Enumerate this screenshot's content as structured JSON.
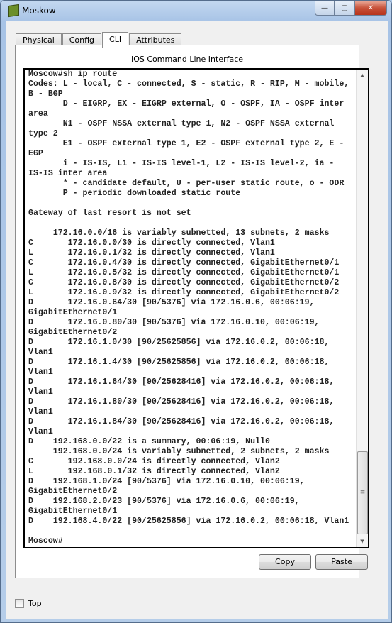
{
  "window": {
    "title": "Moskow",
    "minimize": "—",
    "maximize": "▢",
    "close": "✕"
  },
  "tabs": [
    {
      "label": "Physical",
      "active": false
    },
    {
      "label": "Config",
      "active": false
    },
    {
      "label": "CLI",
      "active": true
    },
    {
      "label": "Attributes",
      "active": false
    }
  ],
  "cli": {
    "heading": "IOS Command Line Interface",
    "output": "Moscow#sh ip route\nCodes: L - local, C - connected, S - static, R - RIP, M - mobile,\nB - BGP\n       D - EIGRP, EX - EIGRP external, O - OSPF, IA - OSPF inter\narea\n       N1 - OSPF NSSA external type 1, N2 - OSPF NSSA external\ntype 2\n       E1 - OSPF external type 1, E2 - OSPF external type 2, E -\nEGP\n       i - IS-IS, L1 - IS-IS level-1, L2 - IS-IS level-2, ia -\nIS-IS inter area\n       * - candidate default, U - per-user static route, o - ODR\n       P - periodic downloaded static route\n\nGateway of last resort is not set\n\n     172.16.0.0/16 is variably subnetted, 13 subnets, 2 masks\nC       172.16.0.0/30 is directly connected, Vlan1\nL       172.16.0.1/32 is directly connected, Vlan1\nC       172.16.0.4/30 is directly connected, GigabitEthernet0/1\nL       172.16.0.5/32 is directly connected, GigabitEthernet0/1\nC       172.16.0.8/30 is directly connected, GigabitEthernet0/2\nL       172.16.0.9/32 is directly connected, GigabitEthernet0/2\nD       172.16.0.64/30 [90/5376] via 172.16.0.6, 00:06:19,\nGigabitEthernet0/1\nD       172.16.0.80/30 [90/5376] via 172.16.0.10, 00:06:19,\nGigabitEthernet0/2\nD       172.16.1.0/30 [90/25625856] via 172.16.0.2, 00:06:18,\nVlan1\nD       172.16.1.4/30 [90/25625856] via 172.16.0.2, 00:06:18,\nVlan1\nD       172.16.1.64/30 [90/25628416] via 172.16.0.2, 00:06:18,\nVlan1\nD       172.16.1.80/30 [90/25628416] via 172.16.0.2, 00:06:18,\nVlan1\nD       172.16.1.84/30 [90/25628416] via 172.16.0.2, 00:06:18,\nVlan1\nD    192.168.0.0/22 is a summary, 00:06:19, Null0\n     192.168.0.0/24 is variably subnetted, 2 subnets, 2 masks\nC       192.168.0.0/24 is directly connected, Vlan2\nL       192.168.0.1/32 is directly connected, Vlan2\nD    192.168.1.0/24 [90/5376] via 172.16.0.10, 00:06:19,\nGigabitEthernet0/2\nD    192.168.2.0/23 [90/5376] via 172.16.0.6, 00:06:19,\nGigabitEthernet0/1\nD    192.168.4.0/22 [90/25625856] via 172.16.0.2, 00:06:18, Vlan1\n\nMoscow#"
  },
  "buttons": {
    "copy": "Copy",
    "paste": "Paste"
  },
  "top_checkbox": {
    "label": "Top",
    "checked": false
  }
}
